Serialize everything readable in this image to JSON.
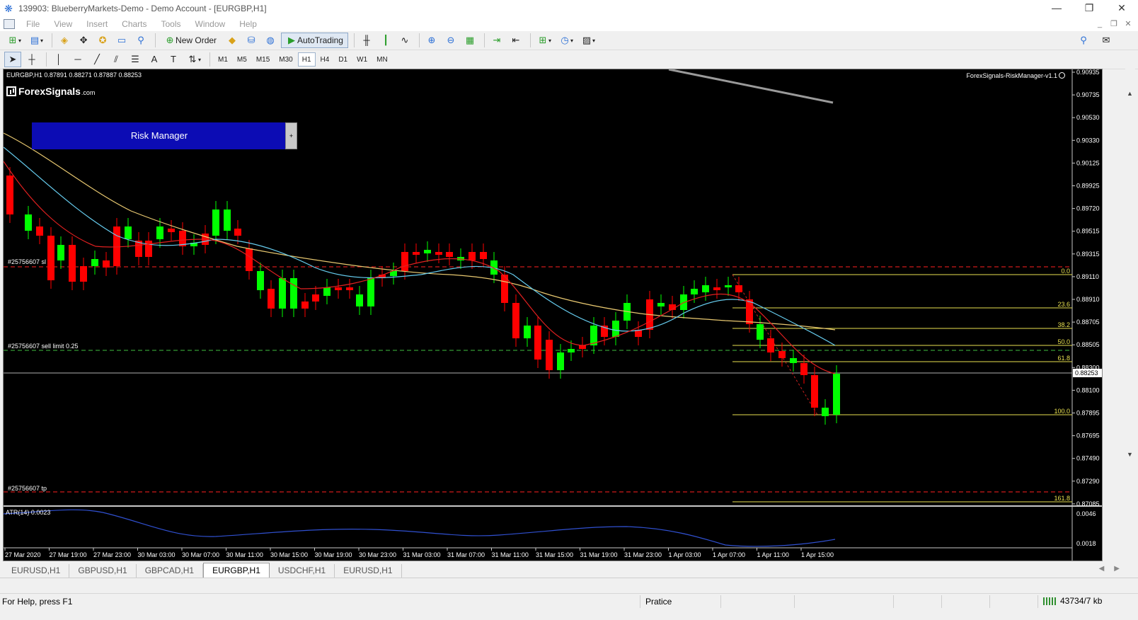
{
  "window": {
    "title": "139903: BlueberryMarkets-Demo - Demo Account - [EURGBP,H1]",
    "controls": [
      "—",
      "❐",
      "✕"
    ]
  },
  "menu": {
    "items": [
      "File",
      "View",
      "Insert",
      "Charts",
      "Tools",
      "Window",
      "Help"
    ],
    "mdi_controls": [
      "_",
      "❐",
      "✕"
    ]
  },
  "toolbar": {
    "new_order_label": "New Order",
    "autotrading_label": "AutoTrading"
  },
  "timeframes": [
    "M1",
    "M5",
    "M15",
    "M30",
    "H1",
    "H4",
    "D1",
    "W1",
    "MN"
  ],
  "active_timeframe": "H1",
  "chart": {
    "ohlc_label": "EURGBP,H1  0.87891 0.88271 0.87887 0.88253",
    "logo_text": "ForexSignals",
    "logo_suffix": ".com",
    "risk_manager_label": "Risk Manager",
    "risk_manager_button": "+",
    "indicator_name": "ForexSignals-RiskManager-v1.1",
    "current_price": "0.88253",
    "price_axis": [
      "0.90935",
      "0.90735",
      "0.90530",
      "0.90330",
      "0.90125",
      "0.89925",
      "0.89720",
      "0.89515",
      "0.89315",
      "0.89110",
      "0.88910",
      "0.88705",
      "0.88505",
      "0.88300",
      "0.88100",
      "0.87895",
      "0.87695",
      "0.87490",
      "0.87290",
      "0.87085"
    ],
    "atr_axis": [
      "0.0046",
      "0.0018"
    ],
    "time_axis": [
      "27 Mar 2020",
      "27 Mar 19:00",
      "27 Mar 23:00",
      "30 Mar 03:00",
      "30 Mar 07:00",
      "30 Mar 11:00",
      "30 Mar 15:00",
      "30 Mar 19:00",
      "30 Mar 23:00",
      "31 Mar 03:00",
      "31 Mar 07:00",
      "31 Mar 11:00",
      "31 Mar 15:00",
      "31 Mar 19:00",
      "31 Mar 23:00",
      "1 Apr 03:00",
      "1 Apr 07:00",
      "1 Apr 11:00",
      "1 Apr 15:00"
    ],
    "order_labels": {
      "sl": "#25756607 sl",
      "sell_limit": "#25756607 sell limit 0.25",
      "tp": "#25756607 tp"
    },
    "fib_levels": [
      "0.0",
      "23.6",
      "38.2",
      "50.0",
      "61.8",
      "100.0",
      "161.8"
    ],
    "atr_label": "ATR(14) 0.0023",
    "colors": {
      "bull": "#00ff00",
      "bear": "#ff0000",
      "ma_fast": "#e02020",
      "ma_mid": "#66ccee",
      "ma_slow": "#e8c870",
      "fib": "#e8e050",
      "sl_tp_line": "#ff2020",
      "entry_line": "#40c040",
      "atr": "#3050d0"
    }
  },
  "tabs": {
    "items": [
      "EURUSD,H1",
      "GBPUSD,H1",
      "GBPCAD,H1",
      "EURGBP,H1",
      "USDCHF,H1",
      "EURUSD,H1"
    ],
    "active_index": 3
  },
  "status": {
    "help_text": "For Help, press F1",
    "profile": "Pratice",
    "connection": "43734/7 kb"
  }
}
